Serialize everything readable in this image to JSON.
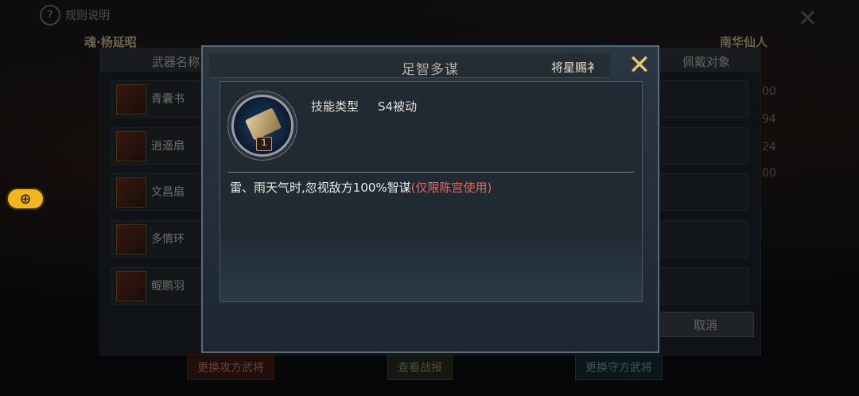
{
  "header": {
    "rules_label": "规则说明",
    "left_general": "魂·杨延昭",
    "right_general": "南华仙人"
  },
  "panel": {
    "col_weapon": "武器名称",
    "col_wearer": "佩戴对象",
    "weapons": [
      "青囊书",
      "逍遥扇",
      "文昌扇",
      "多情环",
      "鲲鹏羽"
    ],
    "right_numbers": [
      "00",
      "94",
      "24",
      "00"
    ],
    "cancel_label": "取消"
  },
  "bottom_buttons": {
    "replace_attack": "更换攻方武将",
    "view_report": "查看战报",
    "replace_defense": "更换守方武将"
  },
  "modal": {
    "title": "足智多谋",
    "tab_label": "将星赐衤",
    "skill_type_label": "技能类型",
    "skill_type_value": "S4被动",
    "skill_level": "1",
    "description_main": "雷、雨天气时,忽视敌方100%智谋",
    "description_note": "(仅限陈宫使用)"
  },
  "colors": {
    "accent_gold": "#e6c672",
    "highlight_red": "#e06a5c"
  }
}
